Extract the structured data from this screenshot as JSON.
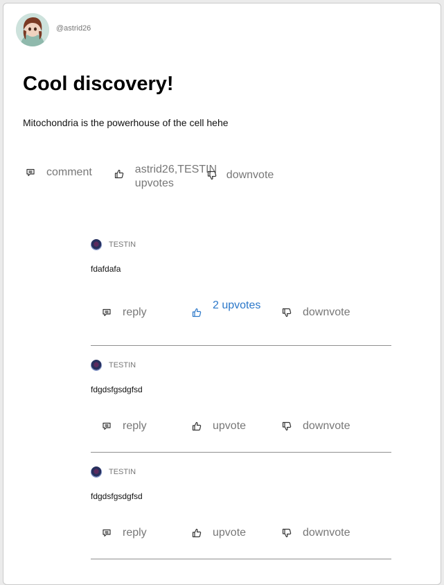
{
  "post": {
    "username": "@astrid26",
    "title": "Cool discovery!",
    "body": "Mitochondria is the powerhouse of the cell hehe",
    "actions": {
      "comment_label": "comment",
      "upvote_label": "astrid26,TESTIN upvotes",
      "downvote_label": "downvote"
    }
  },
  "comments": [
    {
      "author": "TESTIN",
      "text": "fdafdafa",
      "reply_label": "reply",
      "upvote_label": "2 upvotes",
      "upvote_active": true,
      "downvote_label": "downvote"
    },
    {
      "author": "TESTIN",
      "text": "fdgdsfgsdgfsd",
      "reply_label": "reply",
      "upvote_label": "upvote",
      "upvote_active": false,
      "downvote_label": "downvote"
    },
    {
      "author": "TESTIN",
      "text": "fdgdsfgsdgfsd",
      "reply_label": "reply",
      "upvote_label": "upvote",
      "upvote_active": false,
      "downvote_label": "downvote"
    }
  ],
  "colors": {
    "accent": "#2a77c9",
    "muted": "#777777",
    "divider": "#8f8f8f"
  },
  "icons": {
    "comment": "comment-icon",
    "upvote": "thumbs-up-icon",
    "downvote": "thumbs-down-icon"
  }
}
